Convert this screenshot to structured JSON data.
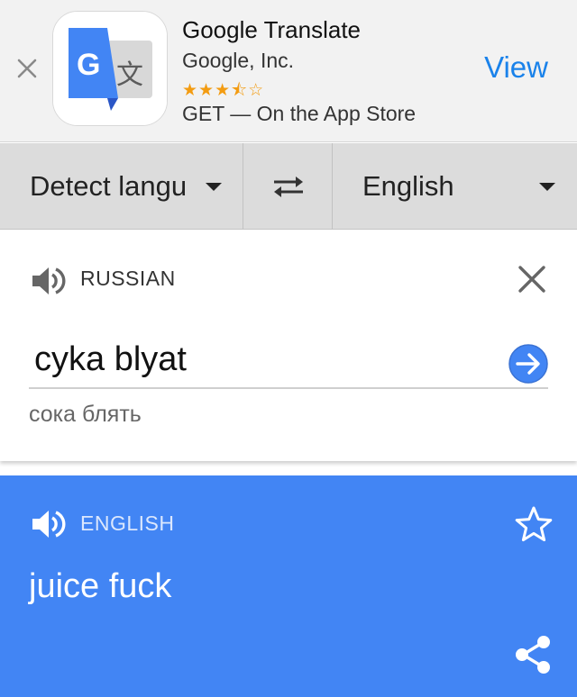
{
  "banner": {
    "close_glyph": "×",
    "app_name": "Google Translate",
    "developer": "Google, Inc.",
    "rating_stars": "★★★⯪☆",
    "rating_value": 3.5,
    "rating_max": 5,
    "get_label": "GET — On the App Store",
    "view_label": "View",
    "icon_letters": {
      "g": "G",
      "wen": "文"
    },
    "colors": {
      "view": "#1a82ea",
      "stars": "#f39c12",
      "icon_blue": "#4285f4",
      "icon_grey": "#d8d8d8"
    }
  },
  "langbar": {
    "source_label": "Detect langu",
    "target_label": "English",
    "swap_icon": "swap-arrows-icon"
  },
  "input": {
    "detected_language": "RUSSIAN",
    "text": "cyka blyat",
    "transliteration": "сока блять",
    "icons": {
      "speaker": "speaker-icon",
      "clear": "close-icon",
      "go": "arrow-right-circle-icon"
    }
  },
  "output": {
    "language": "ENGLISH",
    "text": "juice fuck",
    "icons": {
      "speaker": "speaker-icon",
      "star": "star-outline-icon",
      "share": "share-icon"
    }
  },
  "colors": {
    "accent_blue": "#4285f4",
    "langbar_bg": "#dcdcdc",
    "banner_bg": "#f2f2f2"
  }
}
